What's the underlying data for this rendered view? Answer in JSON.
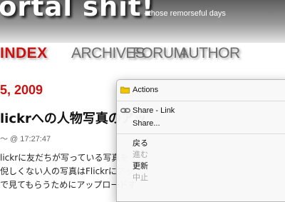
{
  "header": {
    "title": "ortal shit!",
    "tagline": "- those remorseful days"
  },
  "nav": {
    "items": [
      {
        "label": "INDEX"
      },
      {
        "label": "ARCHIVES"
      },
      {
        "label": "FORUM"
      },
      {
        "label": "AUTHOR"
      }
    ]
  },
  "post": {
    "date": "5, 2009",
    "title": "lickrへの人物写真のアッ",
    "meta": "～ @ 17:27:47",
    "body": [
      "lickrに友だちが写っている写真を",
      "倪しくない人の写真はFlickrにアッ",
      "で見てもらうためにアップロードす"
    ]
  },
  "menu": {
    "actions": {
      "label": "Actions",
      "icon": "folder-icon"
    },
    "share_link": {
      "label": "Share - Link",
      "icon": "link-icon"
    },
    "share": {
      "label": "Share..."
    },
    "back": {
      "label": "戻る"
    },
    "forward": {
      "label": "進む"
    },
    "reload": {
      "label": "更新"
    },
    "stop": {
      "label": "中止"
    }
  },
  "colors": {
    "accent_red": "#cc1111",
    "nav_gray": "#6e6e6e",
    "folder_yellow": "#f2c500"
  }
}
